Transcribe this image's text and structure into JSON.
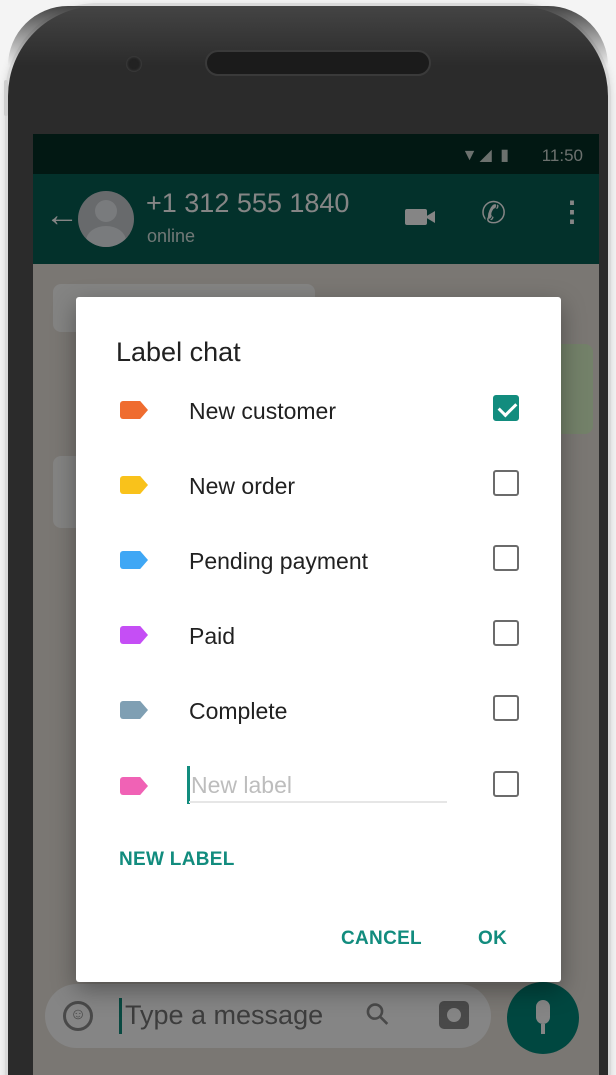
{
  "status_bar": {
    "icons": "▼◢ ▮",
    "time": "11:50"
  },
  "header": {
    "contact_name": "+1 312 555 1840",
    "contact_status": "online"
  },
  "composer": {
    "placeholder": "Type a message"
  },
  "dialog": {
    "title": "Label chat",
    "labels": [
      {
        "text": "New customer",
        "color": "#ef6c2f",
        "checked": true
      },
      {
        "text": "New order",
        "color": "#f9c21b",
        "checked": false
      },
      {
        "text": "Pending payment",
        "color": "#3fa7f5",
        "checked": false
      },
      {
        "text": "Paid",
        "color": "#c54ef5",
        "checked": false
      },
      {
        "text": "Complete",
        "color": "#7f9fb3",
        "checked": false
      }
    ],
    "new_label_row": {
      "color": "#f062b5",
      "placeholder": "New label",
      "checked": false
    },
    "new_label_button": "NEW LABEL",
    "cancel_button": "CANCEL",
    "ok_button": "OK"
  },
  "colors": {
    "app_bar": "#075e54",
    "status_bar": "#042f25",
    "accent": "#128c7e"
  }
}
